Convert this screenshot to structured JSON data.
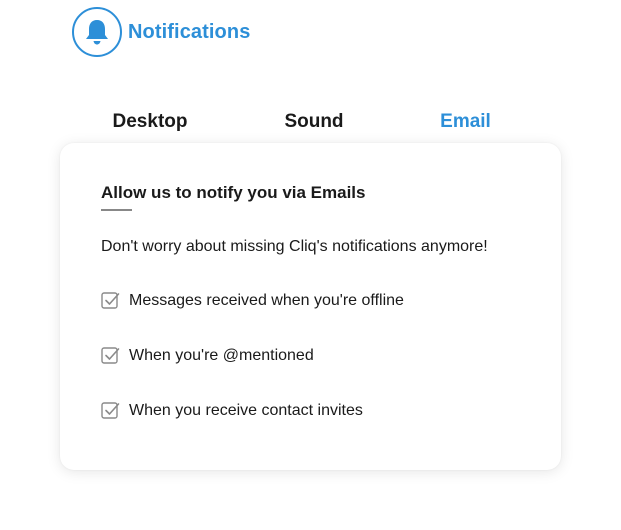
{
  "header": {
    "title": "Notifications",
    "icon": "bell-icon",
    "accent_color": "#2d8fd8"
  },
  "tabs": [
    {
      "label": "Desktop",
      "active": false
    },
    {
      "label": "Sound",
      "active": false
    },
    {
      "label": "Email",
      "active": true
    }
  ],
  "card": {
    "heading": "Allow us to notify you via Emails",
    "description": "Don't worry about missing Cliq's notifications anymore!",
    "options": [
      {
        "label": "Messages received when you're offline",
        "checked": true
      },
      {
        "label": "When you're @mentioned",
        "checked": true
      },
      {
        "label": "When you receive contact invites",
        "checked": true
      }
    ]
  }
}
